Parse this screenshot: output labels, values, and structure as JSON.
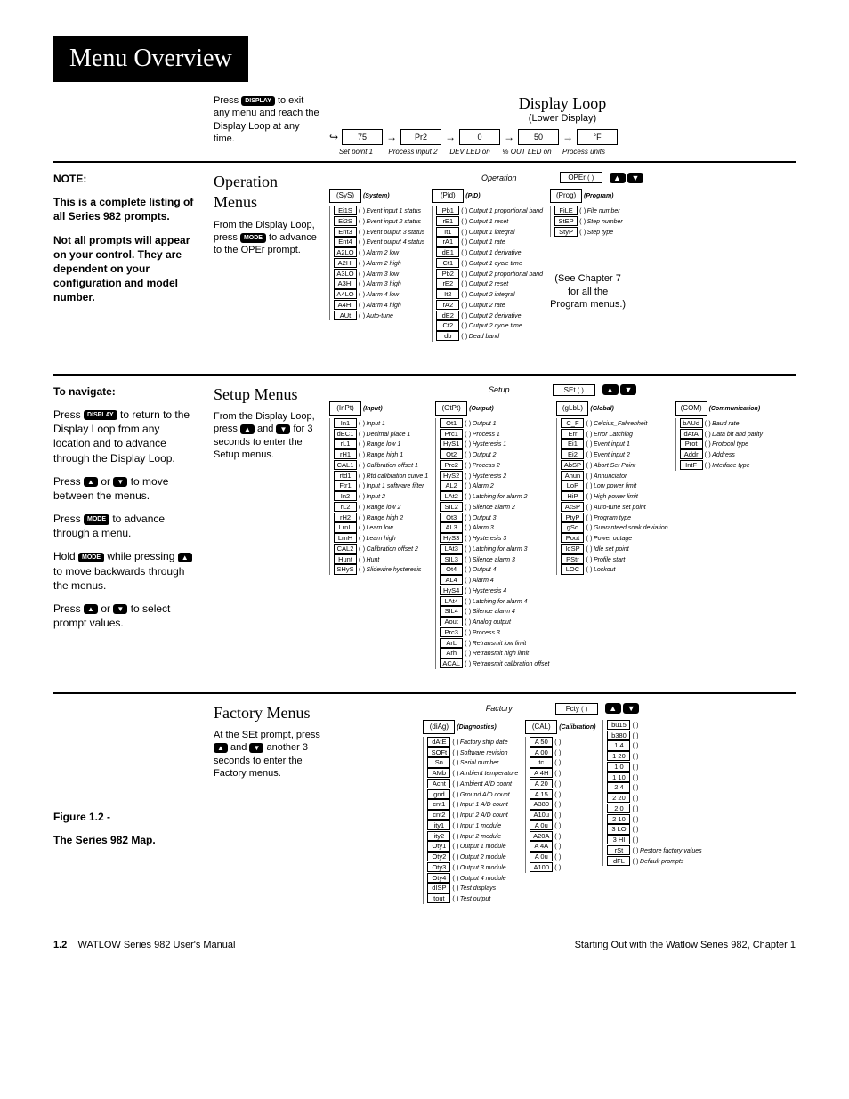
{
  "title": "Menu Overview",
  "display_loop": {
    "heading": "Display Loop",
    "sub": "(Lower Display)",
    "intro": [
      "Press ",
      " to exit any menu and reach the Display Loop at any time."
    ],
    "btn": "DISPLAY",
    "boxes": [
      "75",
      "Pr2",
      "0",
      "50",
      "°F"
    ],
    "labels": [
      "Set point 1",
      "Process input 2",
      "DEV LED on",
      "% OUT LED on",
      "Process units"
    ]
  },
  "note": {
    "heading": "NOTE:",
    "p1": "This is a complete listing of all Series 982 prompts.",
    "p2": "Not all prompts will appear on your control. They are dependent on your configuration and model number."
  },
  "navigate": {
    "heading": "To navigate:",
    "p1a": "Press ",
    "p1btn": "DISPLAY",
    "p1b": " to return to the Display Loop from any location and to advance through the Display Loop.",
    "p2a": "Press ",
    "p2b": " or ",
    "p2c": " to move between the menus.",
    "p3a": "Press ",
    "p3btn": "MODE",
    "p3b": " to advance through a menu.",
    "p4a": "Hold ",
    "p4btn": "MODE",
    "p4b": " while pressing ",
    "p4c": " to move backwards through the menus.",
    "p5a": "Press ",
    "p5b": " or ",
    "p5c": " to select prompt values."
  },
  "operation": {
    "heading": "Operation Menus",
    "intro1": "From the Display Loop, press ",
    "introBtn": "MODE",
    "intro2": " to advance to the OPEr prompt.",
    "barLabel": "Operation",
    "barCode": "OPEr",
    "sys": {
      "head": "(SyS)",
      "title": "(System)",
      "rows": [
        [
          "Ei1S",
          "Event input 1 status"
        ],
        [
          "Ei2S",
          "Event input 2 status"
        ],
        [
          "Ent3",
          "Event output 3 status"
        ],
        [
          "Ent4",
          "Event output 4 status"
        ],
        [
          "A2LO",
          "Alarm 2 low"
        ],
        [
          "A2HI",
          "Alarm 2 high"
        ],
        [
          "A3LO",
          "Alarm 3 low"
        ],
        [
          "A3HI",
          "Alarm 3 high"
        ],
        [
          "A4LO",
          "Alarm 4 low"
        ],
        [
          "A4HI",
          "Alarm 4 high"
        ],
        [
          "AUt",
          "Auto-tune"
        ]
      ]
    },
    "pid": {
      "head": "(Pid)",
      "title": "(PID)",
      "rows": [
        [
          "Pb1",
          "Output 1 proportional band"
        ],
        [
          "rE1",
          "Output 1 reset"
        ],
        [
          "It1",
          "Output 1 integral"
        ],
        [
          "rA1",
          "Output 1 rate"
        ],
        [
          "dE1",
          "Output 1 derivative"
        ],
        [
          "Ct1",
          "Output 1 cycle time"
        ],
        [
          "Pb2",
          "Output 2 proportional band"
        ],
        [
          "rE2",
          "Output 2 reset"
        ],
        [
          "It2",
          "Output 2 integral"
        ],
        [
          "rA2",
          "Output 2 rate"
        ],
        [
          "dE2",
          "Output 2 derivative"
        ],
        [
          "Ct2",
          "Output 2 cycle time"
        ],
        [
          "db",
          "Dead band"
        ]
      ]
    },
    "prog": {
      "head": "(Prog)",
      "title": "(Program)",
      "rows": [
        [
          "FiLE",
          "File number"
        ],
        [
          "StEP",
          "Step number"
        ],
        [
          "StyP",
          "Step type"
        ]
      ],
      "note1": "(See Chapter 7",
      "note2": "for all the",
      "note3": "Program menus.)"
    }
  },
  "setup": {
    "heading": "Setup Menus",
    "intro1": "From the Display Loop, press ",
    "intro2": " and ",
    "intro3": " for 3 seconds to enter the Setup menus.",
    "barLabel": "Setup",
    "barCode": "SEt",
    "input": {
      "head": "(InPt)",
      "title": "(Input)",
      "rows": [
        [
          "In1",
          "Input 1"
        ],
        [
          "dEC1",
          "Decimal place 1"
        ],
        [
          "rL1",
          "Range low 1"
        ],
        [
          "rH1",
          "Range high 1"
        ],
        [
          "CAL1",
          "Calibration offset 1"
        ],
        [
          "rtd1",
          "Rtd calibration curve 1"
        ],
        [
          "Ftr1",
          "Input 1 software filter"
        ],
        [
          "In2",
          "Input 2"
        ],
        [
          "rL2",
          "Range low 2"
        ],
        [
          "rH2",
          "Range high 2"
        ],
        [
          "LrnL",
          "Learn low"
        ],
        [
          "LrnH",
          "Learn high"
        ],
        [
          "CAL2",
          "Calibration offset 2"
        ],
        [
          "Hunt",
          "Hunt"
        ],
        [
          "SHyS",
          "Slidewire hysteresis"
        ]
      ]
    },
    "output": {
      "head": "(OtPt)",
      "title": "(Output)",
      "rows": [
        [
          "Ot1",
          "Output 1"
        ],
        [
          "Prc1",
          "Process 1"
        ],
        [
          "HyS1",
          "Hysteresis 1"
        ],
        [
          "Ot2",
          "Output 2"
        ],
        [
          "Prc2",
          "Process 2"
        ],
        [
          "HyS2",
          "Hysteresis 2"
        ],
        [
          "AL2",
          "Alarm 2"
        ],
        [
          "LAt2",
          "Latching for alarm 2"
        ],
        [
          "SIL2",
          "Silence alarm 2"
        ],
        [
          "Ot3",
          "Output 3"
        ],
        [
          "AL3",
          "Alarm 3"
        ],
        [
          "HyS3",
          "Hysteresis 3"
        ],
        [
          "LAt3",
          "Latching for alarm 3"
        ],
        [
          "SIL3",
          "Silence alarm 3"
        ],
        [
          "Ot4",
          "Output 4"
        ],
        [
          "AL4",
          "Alarm 4"
        ],
        [
          "HyS4",
          "Hysteresis 4"
        ],
        [
          "LAt4",
          "Latching for alarm 4"
        ],
        [
          "SIL4",
          "Silence alarm 4"
        ],
        [
          "Aout",
          "Analog output"
        ],
        [
          "Prc3",
          "Process 3"
        ],
        [
          "ArL",
          "Retransmit low limit"
        ],
        [
          "Arh",
          "Retransmit high limit"
        ],
        [
          "ACAL",
          "Retransmit calibration offset"
        ]
      ]
    },
    "global": {
      "head": "(gLbL)",
      "title": "(Global)",
      "rows": [
        [
          "C_F",
          "Celcius_Fahrenheit"
        ],
        [
          "Err",
          "Error Latching"
        ],
        [
          "Ei1",
          "Event input 1"
        ],
        [
          "Ei2",
          "Event input 2"
        ],
        [
          "AbSP",
          "Abort Set Point"
        ],
        [
          "Anun",
          "Annunciator"
        ],
        [
          "LoP",
          "Low power limit"
        ],
        [
          "HiP",
          "High power limit"
        ],
        [
          "AtSP",
          "Auto-tune set point"
        ],
        [
          "PtyP",
          "Program type"
        ],
        [
          "gSd",
          "Guaranteed soak deviation"
        ],
        [
          "Pout",
          "Power outage"
        ],
        [
          "IdSP",
          "Idle set point"
        ],
        [
          "PStr",
          "Profile start"
        ],
        [
          "LOC",
          "Lockout"
        ]
      ]
    },
    "com": {
      "head": "(COM)",
      "title": "(Communication)",
      "rows": [
        [
          "bAUd",
          "Baud rate"
        ],
        [
          "dAtA",
          "Data bit and parity"
        ],
        [
          "Prot",
          "Protocol type"
        ],
        [
          "Addr",
          "Address"
        ],
        [
          "IntF",
          "Interface type"
        ]
      ]
    }
  },
  "factory": {
    "heading": "Factory Menus",
    "intro1": "At the SEt prompt, press ",
    "intro2": " and ",
    "intro3": " another 3 seconds to enter the Factory menus.",
    "barLabel": "Factory",
    "barCode": "Fcty",
    "diag": {
      "head": "(diAg)",
      "title": "(Diagnostics)",
      "rows": [
        [
          "dAtE",
          "Factory ship date"
        ],
        [
          "SOFt",
          "Software revision"
        ],
        [
          "Sn",
          "Serial number"
        ],
        [
          "AMb",
          "Ambient temperature"
        ],
        [
          "Acnt",
          "Ambient A/D count"
        ],
        [
          "gnd",
          "Ground A/D count"
        ],
        [
          "cnt1",
          "Input 1 A/D count"
        ],
        [
          "cnt2",
          "Input 2 A/D count"
        ],
        [
          "ity1",
          "Input 1 module"
        ],
        [
          "ity2",
          "Input 2 module"
        ],
        [
          "Oty1",
          "Output 1 module"
        ],
        [
          "Oty2",
          "Output 2 module"
        ],
        [
          "Oty3",
          "Output 3 module"
        ],
        [
          "Oty4",
          "Output 4 module"
        ],
        [
          "dISP",
          "Test displays"
        ],
        [
          "tout",
          "Test output"
        ]
      ]
    },
    "cal": {
      "head": "(CAL)",
      "title": "(Calibration)",
      "col1": [
        "A 50",
        "A 00",
        "tc",
        "A 4H",
        "A 20",
        "A 15",
        "A380",
        "A10u",
        "A 0u",
        "A20A",
        "A 4A",
        "A 0u",
        "A100"
      ],
      "col2": [
        "bu15",
        "b380",
        "1 4",
        "1 20",
        "1 0",
        "1 10",
        "2 4",
        "2 20",
        "2 0",
        "2 10",
        "3 LO",
        "3 HI",
        "rSt",
        "dFL"
      ],
      "col2desc": {
        "12": "Restore factory values",
        "13": "Default prompts"
      }
    }
  },
  "figure": {
    "num": "Figure 1.2 -",
    "title": "The Series 982 Map."
  },
  "footer": {
    "page": "1.2",
    "left": "WATLOW Series 982 User's Manual",
    "right": "Starting Out with the Watlow Series 982, Chapter 1"
  }
}
